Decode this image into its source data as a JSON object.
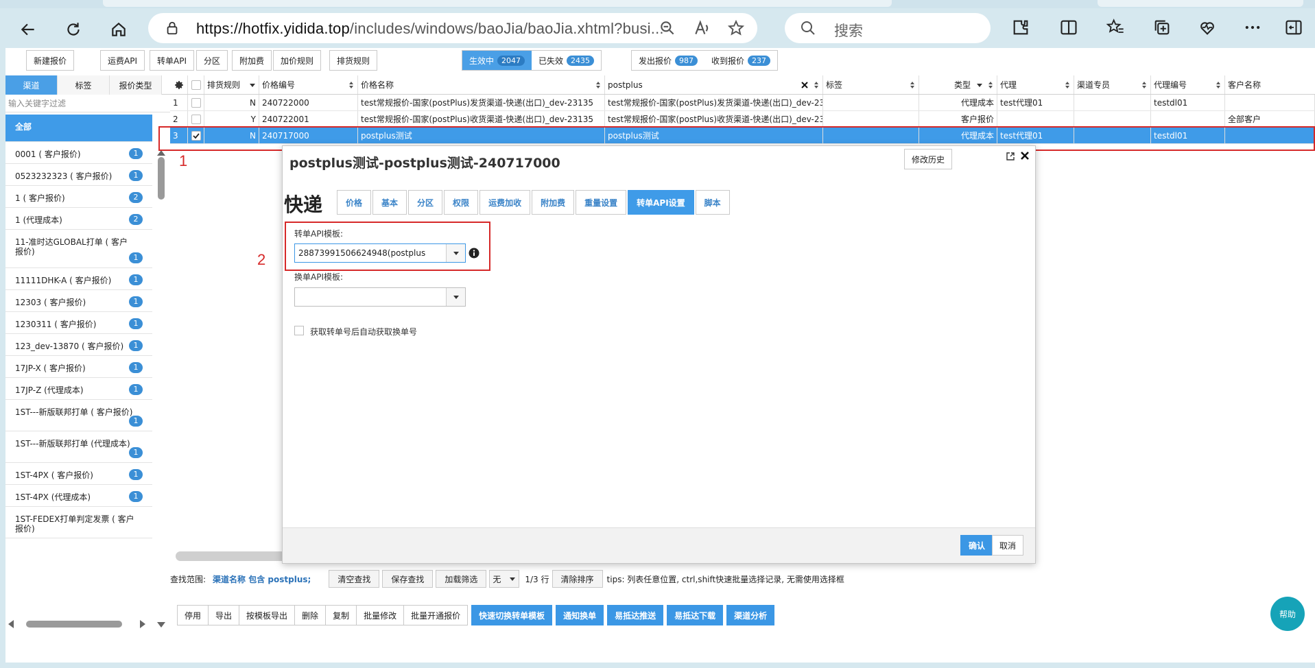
{
  "browser": {
    "url_domain": "https://hotfix.yidida.top",
    "url_path": "/includes/windows/baoJia/baoJia.xhtml?busi...",
    "search_placeholder": "搜索"
  },
  "toolbar": {
    "buttons": [
      "新建报价",
      "运费API",
      "转单API",
      "分区",
      "附加费",
      "加价规则",
      "排货规则"
    ],
    "status_active": {
      "label": "生效中",
      "count": "2047"
    },
    "status_expired": {
      "label": "已失效",
      "count": "2435"
    },
    "sent": {
      "label": "发出报价",
      "count": "987"
    },
    "received": {
      "label": "收到报价",
      "count": "237"
    }
  },
  "left": {
    "tabs": [
      "渠道",
      "标签",
      "报价类型"
    ],
    "filter_placeholder": "输入关键字过滤",
    "items": [
      {
        "label": "全部",
        "badge": ""
      },
      {
        "label": "0001 ( 客户报价)",
        "badge": "1"
      },
      {
        "label": "0523232323 ( 客户报价)",
        "badge": "1"
      },
      {
        "label": "1 ( 客户报价)",
        "badge": "2"
      },
      {
        "label": "1 (代理成本)",
        "badge": "2"
      },
      {
        "label": "11-准时达GLOBAL打单 ( 客户报价)",
        "badge": "1"
      },
      {
        "label": "11111DHK-A ( 客户报价)",
        "badge": "1"
      },
      {
        "label": "12303 ( 客户报价)",
        "badge": "1"
      },
      {
        "label": "1230311 ( 客户报价)",
        "badge": "1"
      },
      {
        "label": "123_dev-13870 ( 客户报价)",
        "badge": "1"
      },
      {
        "label": "17JP-X ( 客户报价)",
        "badge": "1"
      },
      {
        "label": "17JP-Z (代理成本)",
        "badge": "1"
      },
      {
        "label": "1ST---新版联邦打单 ( 客户报价)",
        "badge": "1"
      },
      {
        "label": "1ST---新版联邦打单 (代理成本)",
        "badge": "1"
      },
      {
        "label": "1ST-4PX ( 客户报价)",
        "badge": "1"
      },
      {
        "label": "1ST-4PX (代理成本)",
        "badge": "1"
      },
      {
        "label": "1ST-FEDEX打单判定发票 ( 客户报价)",
        "badge": ""
      }
    ]
  },
  "grid": {
    "headers": [
      "排货规则",
      "价格编号",
      "价格名称",
      "postplus",
      "标签",
      "类型",
      "代理",
      "渠道专员",
      "代理编号",
      "客户名称"
    ],
    "rows": [
      [
        "1",
        "N",
        "240722000",
        "test常规报价-国家(postPlus)发货渠道-快递(出口)_dev-23135",
        "test常规报价-国家(postPlus)发货渠道-快递(出口)_dev-23135",
        "",
        "代理成本",
        "test代理01",
        "",
        "testdl01",
        ""
      ],
      [
        "2",
        "Y",
        "240722001",
        "test常规报价-国家(postPlus)收货渠道-快递(出口)_dev-23135",
        "test常规报价-国家(postPlus)收货渠道-快递(出口)_dev-23135",
        "",
        "客户报价",
        "",
        "",
        "",
        "全部客户"
      ],
      [
        "3",
        "N",
        "240717000",
        "postplus测试",
        "postplus测试",
        "",
        "代理成本",
        "test代理01",
        "",
        "testdl01",
        ""
      ]
    ]
  },
  "annotations": [
    "1",
    "2"
  ],
  "modal": {
    "title": "postplus测试-postplus测试-240717000",
    "history_label": "修改历史",
    "logo_text": "快递",
    "tabs": [
      "价格",
      "基本",
      "分区",
      "权限",
      "运费加收",
      "附加费",
      "重量设置",
      "转单API设置",
      "脚本"
    ],
    "transfer_label": "转单API模板:",
    "transfer_value": "28873991506624948(postplus",
    "exchange_label": "换单API模板:",
    "exchange_value": "",
    "auto_label": "获取转单号后自动获取换单号",
    "ok_label": "确认",
    "cancel_label": "取消"
  },
  "search": {
    "scope_label": "查找范围:",
    "scope_value": "渠道名称 包含 postplus;",
    "clear": "清空查找",
    "save": "保存查找",
    "load": "加载筛选",
    "none_option": "无",
    "rows_info": "1/3 行",
    "clear_sort": "清除排序",
    "tips": "tips: 列表任意位置, ctrl,shift快速批量选择记录, 无需使用选择框"
  },
  "actions": {
    "plain": [
      "停用",
      "导出",
      "按模板导出",
      "删除",
      "复制",
      "批量修改",
      "批量开通报价"
    ],
    "blue": [
      "快速切换转单模板",
      "通知换单",
      "易抵达推送",
      "易抵达下载",
      "渠道分析"
    ]
  },
  "help_label": "帮助",
  "colors": {
    "accent": "#3f9be8",
    "annotation": "#d62828",
    "help": "#16a3b8"
  }
}
